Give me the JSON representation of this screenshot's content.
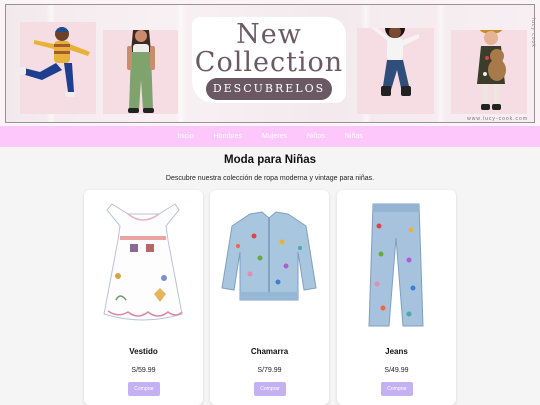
{
  "hero": {
    "title_line1": "New",
    "title_line2": "Collection",
    "cta_label": "DESCUBRELOS",
    "site_url": "www.lucy-cook.com",
    "side_text": "lucy cook"
  },
  "nav": {
    "items": [
      {
        "label": "Inicio"
      },
      {
        "label": "Hombres"
      },
      {
        "label": "Mujeres"
      },
      {
        "label": "Niños"
      },
      {
        "label": "Niñas"
      }
    ]
  },
  "main": {
    "title": "Moda para Niñas",
    "subtitle": "Descubre nuestra colección de ropa moderna y vintage para niñas."
  },
  "products": [
    {
      "name": "Vestido",
      "price": "S/59.99",
      "button": "Comprar",
      "image_icon": "white-dress-icon"
    },
    {
      "name": "Chamarra",
      "price": "S/79.99",
      "button": "Comprar",
      "image_icon": "denim-jacket-icon"
    },
    {
      "name": "Jeans",
      "price": "S/49.99",
      "button": "Comprar",
      "image_icon": "jeans-icon"
    }
  ],
  "colors": {
    "nav_bg": "#fdc7fb",
    "button_bg": "#c4b1f3",
    "cta_bg": "#6a5863",
    "page_bg": "#f6f5f6"
  }
}
